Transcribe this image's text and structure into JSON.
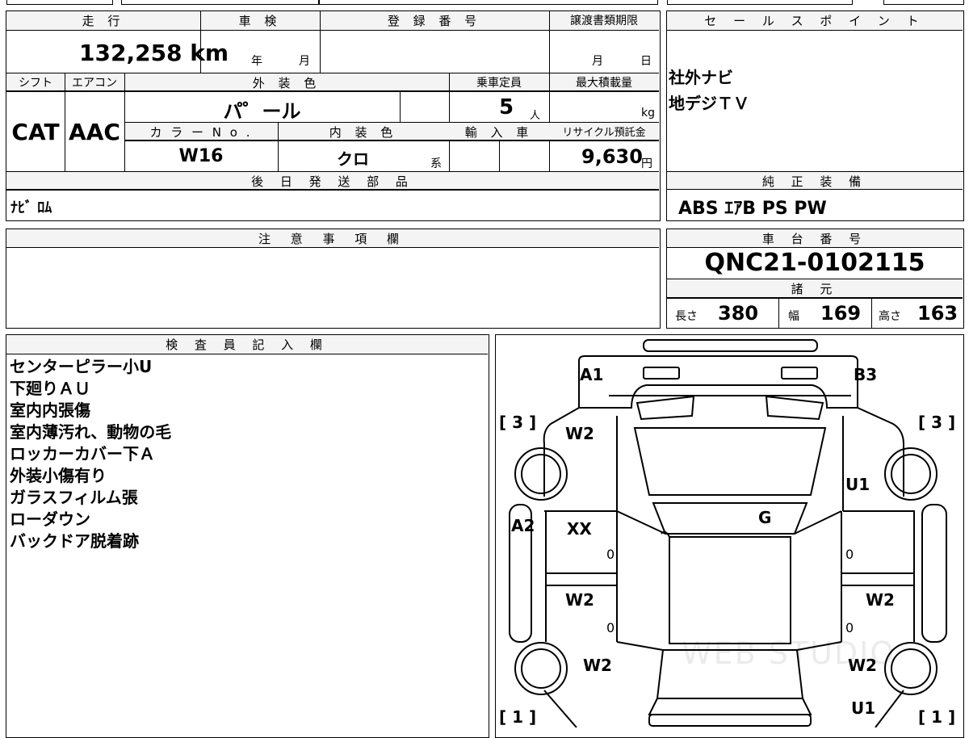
{
  "top_strip": {
    "cell1": "",
    "cell2": "",
    "cell3": ""
  },
  "header_row": {
    "mileage_label": "走 行",
    "inspection_label": "車 検",
    "registration_label": "登 録 番 号",
    "transfer_deadline_label": "譲渡書類期限",
    "mileage_value": "132,258",
    "mileage_unit": "km",
    "year_label": "年",
    "month_label": "月",
    "deadline_month": "月",
    "deadline_day": "日"
  },
  "spec_row": {
    "shift_label": "シフト",
    "aircon_label": "エアコン",
    "exterior_color_label": "外 装 色",
    "capacity_label": "乗車定員",
    "max_load_label": "最大積載量",
    "shift_value": "CAT",
    "aircon_value": "AAC",
    "exterior_color_value": "パ゜ール",
    "capacity_value": "5",
    "capacity_unit": "人",
    "load_unit": "kg",
    "color_no_label": "カ ラ ー N o .",
    "interior_color_label": "内 装 色",
    "import_label": "輸 入 車",
    "recycle_label": "リサイクル預託金",
    "color_no_value": "W16",
    "interior_color_value": "クロ",
    "interior_suffix": "系",
    "recycle_value": "9,630",
    "recycle_unit": "円"
  },
  "later_parts": {
    "label": "後 日 発 送 部 品",
    "value": "ﾅﾋﾞ ﾛﾑ"
  },
  "sale_points": {
    "label": "セ ー ル ス ポ イ ン ト",
    "lines": [
      "社外ナビ",
      "地デジＴＶ"
    ]
  },
  "genuine_equipment": {
    "label": "純 正 装 備",
    "value": "ABS ｴｱB PS PW"
  },
  "notes": {
    "label": "注 意 事 項 欄"
  },
  "chassis": {
    "label": "車 台 番 号",
    "value": "QNC21-0102115"
  },
  "dimensions": {
    "label": "諸 元",
    "length_label": "長さ",
    "length_value": "380",
    "width_label": "幅",
    "width_value": "169",
    "height_label": "高さ",
    "height_value": "163"
  },
  "inspector": {
    "label": "検 査 員 記 入 欄",
    "lines": [
      "センターピラー小U",
      "下廻りＡＵ",
      "室内内張傷",
      "室内薄汚れ、動物の毛",
      "ロッカーカバー下Ａ",
      "外装小傷有り",
      "ガラスフィルム張",
      "ローダウン",
      "バックドア脱着跡"
    ]
  },
  "car_map": {
    "marks": {
      "a1": "A1",
      "b3": "B3",
      "bracket_tl": "[ 3 ]",
      "bracket_tr": "[ 3 ]",
      "bracket_bl": "[ 1 ]",
      "bracket_br": "[ 1 ]",
      "w2_front_left": "W2",
      "u1_front_right": "U1",
      "a2": "A2",
      "xx": "XX",
      "g": "G",
      "w2_rear_door_left": "W2",
      "w2_rear_door_right": "W2",
      "w2_rear_left": "W2",
      "w2_rear_right": "W2",
      "u1_rear_right": "U1",
      "zero_1": "0",
      "zero_2": "0",
      "zero_3": "0",
      "zero_4": "0"
    },
    "watermark": "WEB STUDIO"
  }
}
